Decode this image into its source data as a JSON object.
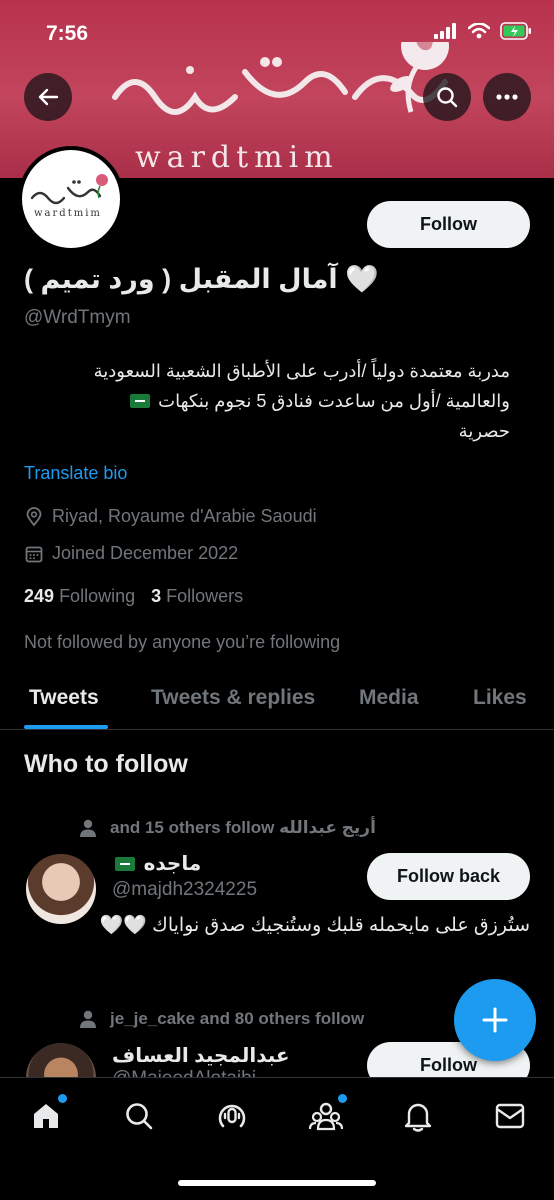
{
  "status": {
    "time": "7:56"
  },
  "banner": {
    "logo_ar": "ورد تميم",
    "logo_latin": "wardtmim"
  },
  "avatar": {
    "logo_ar": "ورد تميم",
    "logo_latin": "wardtmim"
  },
  "profile": {
    "follow_label": "Follow",
    "display_name": "آمال المقبل ( ورد تميم ) 🤍",
    "handle": "@WrdTmym",
    "bio_line1": "مدربة معتمدة دولياً /أدرب على الأطباق الشعبية السعودية",
    "bio_line2": "والعالمية /أول من ساعدت فنادق 5 نجوم بنكهات",
    "bio_line3": "حصرية",
    "translate": "Translate bio",
    "location": "Riyad, Royaume d'Arabie Saoudi",
    "joined": "Joined December 2022",
    "following_count": "249",
    "following_label": "Following",
    "followers_count": "3",
    "followers_label": "Followers",
    "not_followed": "Not followed by anyone you’re following"
  },
  "tabs": [
    "Tweets",
    "Tweets & replies",
    "Media",
    "Likes"
  ],
  "who_to_follow": {
    "title": "Who to follow",
    "users": [
      {
        "social_context": "and 15 others follow أريج عبدالله",
        "name": "ماجده",
        "handle": "@majdh2324225",
        "bio": "ستُرزق على مايحمله قلبك وستُنجيك صدق نواياك 🤍🤍",
        "button": "Follow back"
      },
      {
        "social_context": "je_je_cake and 80 others follow",
        "name": "عبدالمجيد العساف",
        "handle": "@MajeedAlotaibi",
        "button": "Follow"
      }
    ]
  },
  "colors": {
    "accent": "#1d9bf0",
    "banner": "#b8324e",
    "background": "#000000"
  },
  "nav_icons": [
    "home-icon",
    "search-icon",
    "spaces-icon",
    "communities-icon",
    "notifications-icon",
    "messages-icon"
  ]
}
